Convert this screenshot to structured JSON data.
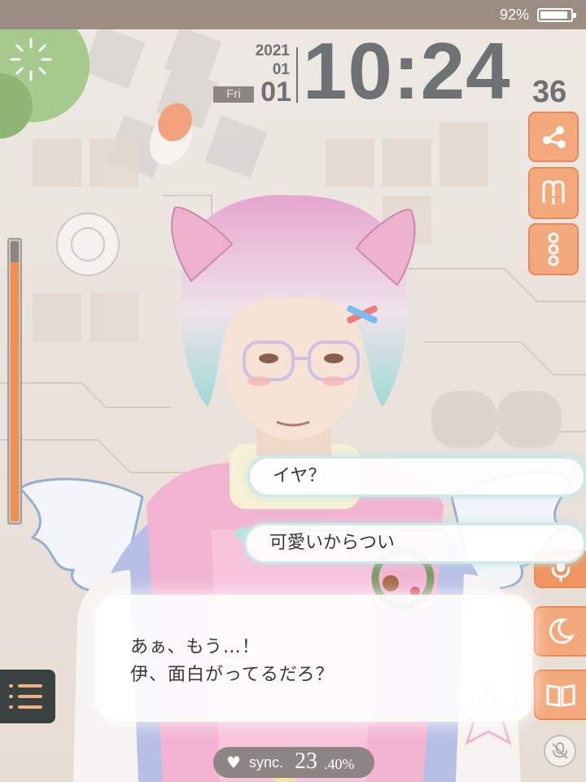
{
  "status_bar": {
    "battery_percent_label": "92%",
    "battery_level": 0.92
  },
  "clock": {
    "year": "2021",
    "month": "01",
    "weekday": "Fri",
    "day": "01",
    "time": "10:24",
    "seconds": "36"
  },
  "right_buttons": [
    {
      "icon": "share-icon"
    },
    {
      "icon": "memory-icon"
    },
    {
      "icon": "more-icon"
    },
    {
      "icon": "microphone-icon"
    },
    {
      "icon": "moon-icon"
    },
    {
      "icon": "book-icon"
    },
    {
      "icon": "mic-mute-icon"
    }
  ],
  "gauge": {
    "level": 0.93
  },
  "chat": {
    "choices": [
      "イヤ？",
      "可愛いからつい"
    ],
    "dialog_lines": [
      "あぁ、もう…！",
      "伊、面白がってるだろ？"
    ]
  },
  "menu": {
    "icon": "menu-icon"
  },
  "sync": {
    "label": "sync.",
    "value_int": "23",
    "value_dec": ".40%"
  },
  "colors": {
    "accent_orange": "#f3a97c",
    "clock_gray": "#6f7274",
    "status_bar": "#9d8c82",
    "menu_dark": "#3a4241"
  }
}
